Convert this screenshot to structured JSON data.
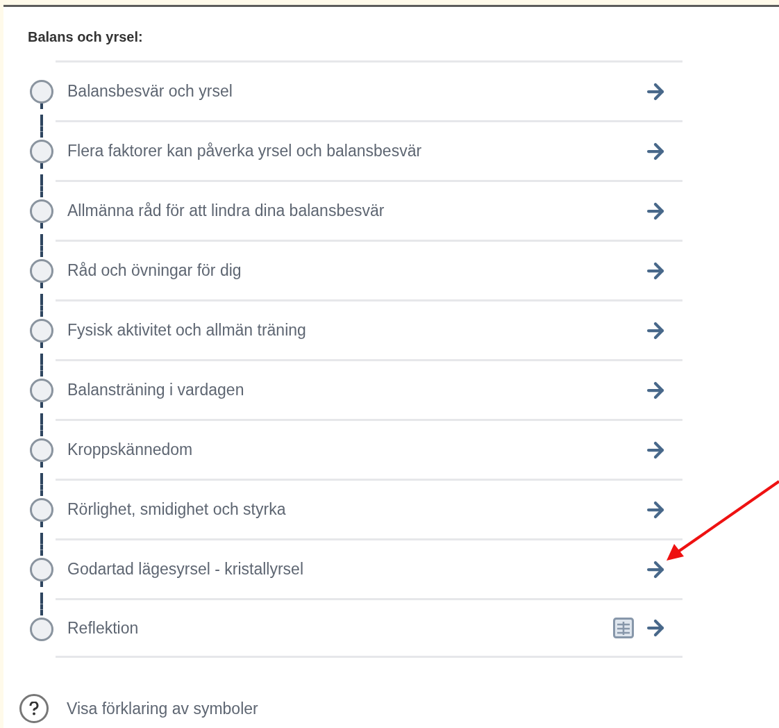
{
  "heading": "Balans och yrsel:",
  "items": [
    {
      "label": "Balansbesvär och yrsel",
      "done": false,
      "worksheet": false
    },
    {
      "label": "Flera faktorer kan påverka yrsel och balansbesvär",
      "done": false,
      "worksheet": false
    },
    {
      "label": "Allmänna råd för att lindra dina balansbesvär",
      "done": false,
      "worksheet": false
    },
    {
      "label": "Råd och övningar för dig",
      "done": false,
      "worksheet": false
    },
    {
      "label": "Fysisk aktivitet och allmän träning",
      "done": false,
      "worksheet": false
    },
    {
      "label": "Balansträning i vardagen",
      "done": false,
      "worksheet": false
    },
    {
      "label": "Kroppskännedom",
      "done": false,
      "worksheet": false
    },
    {
      "label": "Rörlighet, smidighet och styrka",
      "done": false,
      "worksheet": false
    },
    {
      "label": "Godartad lägesyrsel - kristallyrsel",
      "done": false,
      "worksheet": false
    },
    {
      "label": "Reflektion",
      "done": false,
      "worksheet": true
    }
  ],
  "help_link": "Visa förklaring av symboler"
}
